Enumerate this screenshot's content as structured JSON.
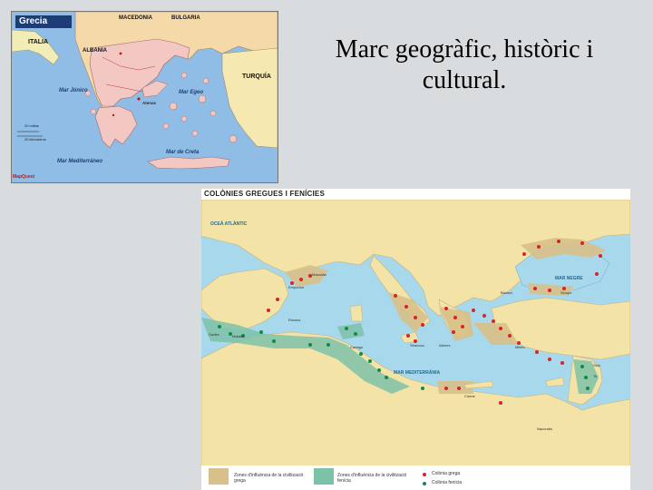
{
  "slide": {
    "title": "Marc geogràfic, històric i cultural."
  },
  "map_greece": {
    "title": "Grecia",
    "labels": {
      "italia": "ITALIA",
      "albania": "ALBANIA",
      "macedonia": "MACEDONIA",
      "bulgaria": "BULGARIA",
      "turquia": "TURQUÍA",
      "mar_jonico": "Mar Jónico",
      "mar_egeo": "Mar Egeo",
      "mar_mediterraneo": "Mar Mediterráneo",
      "mar_de_creta": "Mar de Creta",
      "atenas": "Atenas"
    },
    "scale": [
      "20 millas",
      "20 kilómetros"
    ],
    "credit": "MapQuest"
  },
  "map_colonies": {
    "title": "COLÒNIES GREGUES I FENÍCIES",
    "seas": {
      "atlantic": "OCEÀ ATLÀNTIC",
      "black_sea": "MAR NEGRE",
      "mediterranean": "MAR MEDITERRÀNIA"
    },
    "places": [
      "Massàlia",
      "Empòrion",
      "Cartago",
      "Siracusa",
      "Bizanci",
      "Atenes",
      "Tir",
      "Sidó",
      "Cirene",
      "Naucratis",
      "Gades",
      "Ebusus",
      "Malaka",
      "Sinope",
      "Mileto"
    ],
    "legend": {
      "greek_zone": "Zones d'influència de la civilització grega",
      "phoenician_zone": "Zones d'influència de la civilització fenícia",
      "greek_colony": "Colònia grega",
      "phoenician_colony": "Colònia fenícia"
    },
    "colors": {
      "sea": "#a8d8ec",
      "land": "#f3e3a6",
      "greek_zone": "#d8c08a",
      "phoenician_zone": "#7cc2a8",
      "greek_dot": "#d6242a",
      "phoenician_dot": "#138a4a"
    }
  }
}
